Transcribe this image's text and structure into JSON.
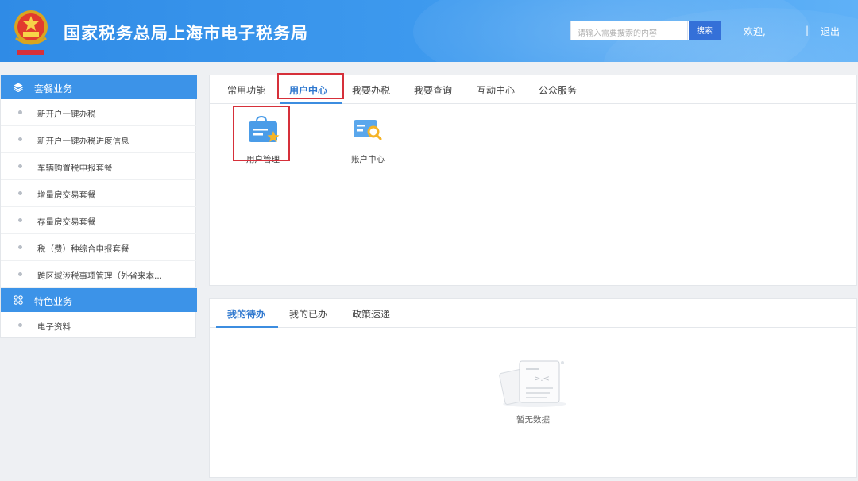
{
  "header": {
    "title": "国家税务总局上海市电子税务局",
    "search_placeholder": "请输入需要搜索的内容",
    "search_button": "搜索",
    "welcome": "欢迎,",
    "separator": "|",
    "logout": "退出"
  },
  "sidebar": {
    "sections": [
      {
        "title": "套餐业务",
        "icon": "layers-icon",
        "items": [
          "新开户一键办税",
          "新开户一键办税进度信息",
          "车辆购置税申报套餐",
          "增量房交易套餐",
          "存量房交易套餐",
          "税（费）种综合申报套餐",
          "跨区域涉税事项管理（外省来本..."
        ]
      },
      {
        "title": "特色业务",
        "icon": "grid-icon",
        "items": [
          "电子资料"
        ]
      }
    ]
  },
  "top_panel": {
    "tabs": [
      "常用功能",
      "用户中心",
      "我要办税",
      "我要查询",
      "互动中心",
      "公众服务"
    ],
    "active_tab": "用户中心",
    "functions": [
      {
        "label": "用户管理",
        "icon": "user-management-icon"
      },
      {
        "label": "账户中心",
        "icon": "account-center-icon"
      }
    ]
  },
  "bottom_panel": {
    "tabs": [
      "我的待办",
      "我的已办",
      "政策速递"
    ],
    "active_tab": "我的待办",
    "empty_text": "暂无数据"
  },
  "colors": {
    "header_blue": "#3a93ea",
    "accent_blue": "#3c93e8",
    "highlight_red": "#d6303a",
    "active_tab_text": "#2f78cf"
  }
}
